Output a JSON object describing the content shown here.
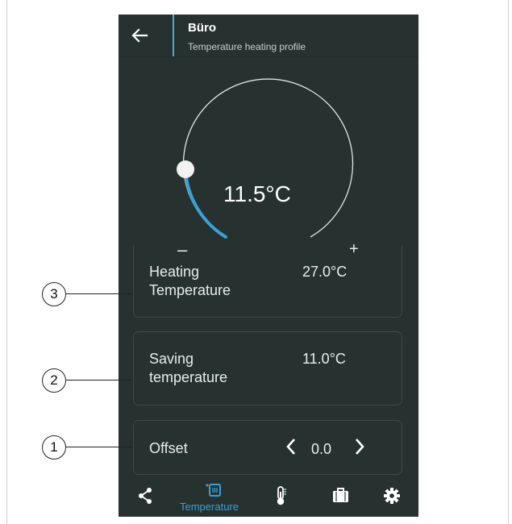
{
  "header": {
    "title": "Büro",
    "subtitle": "Temperature heating profile"
  },
  "dial": {
    "value": "11.5°C",
    "minus_label": "–",
    "plus_label": "+",
    "level": 0.115
  },
  "cards": {
    "heating": {
      "label_line1": "Heating",
      "label_line2": "Temperature",
      "value": "27.0°C"
    },
    "saving": {
      "label_line1": "Saving",
      "label_line2": "temperature",
      "value": "11.0°C"
    },
    "offset": {
      "label": "Offset",
      "value": "0.0"
    }
  },
  "bottom_nav": {
    "active_label": "Temperature",
    "items": [
      "share-icon",
      "temperature-icon",
      "thermometer-icon",
      "briefcase-icon",
      "gear-icon"
    ]
  },
  "callouts": [
    "3",
    "2",
    "1"
  ],
  "colors": {
    "screen_bg": "#273230",
    "accent": "#3aa0d6",
    "text": "#e9ecea",
    "card_border": "#3c4845"
  }
}
